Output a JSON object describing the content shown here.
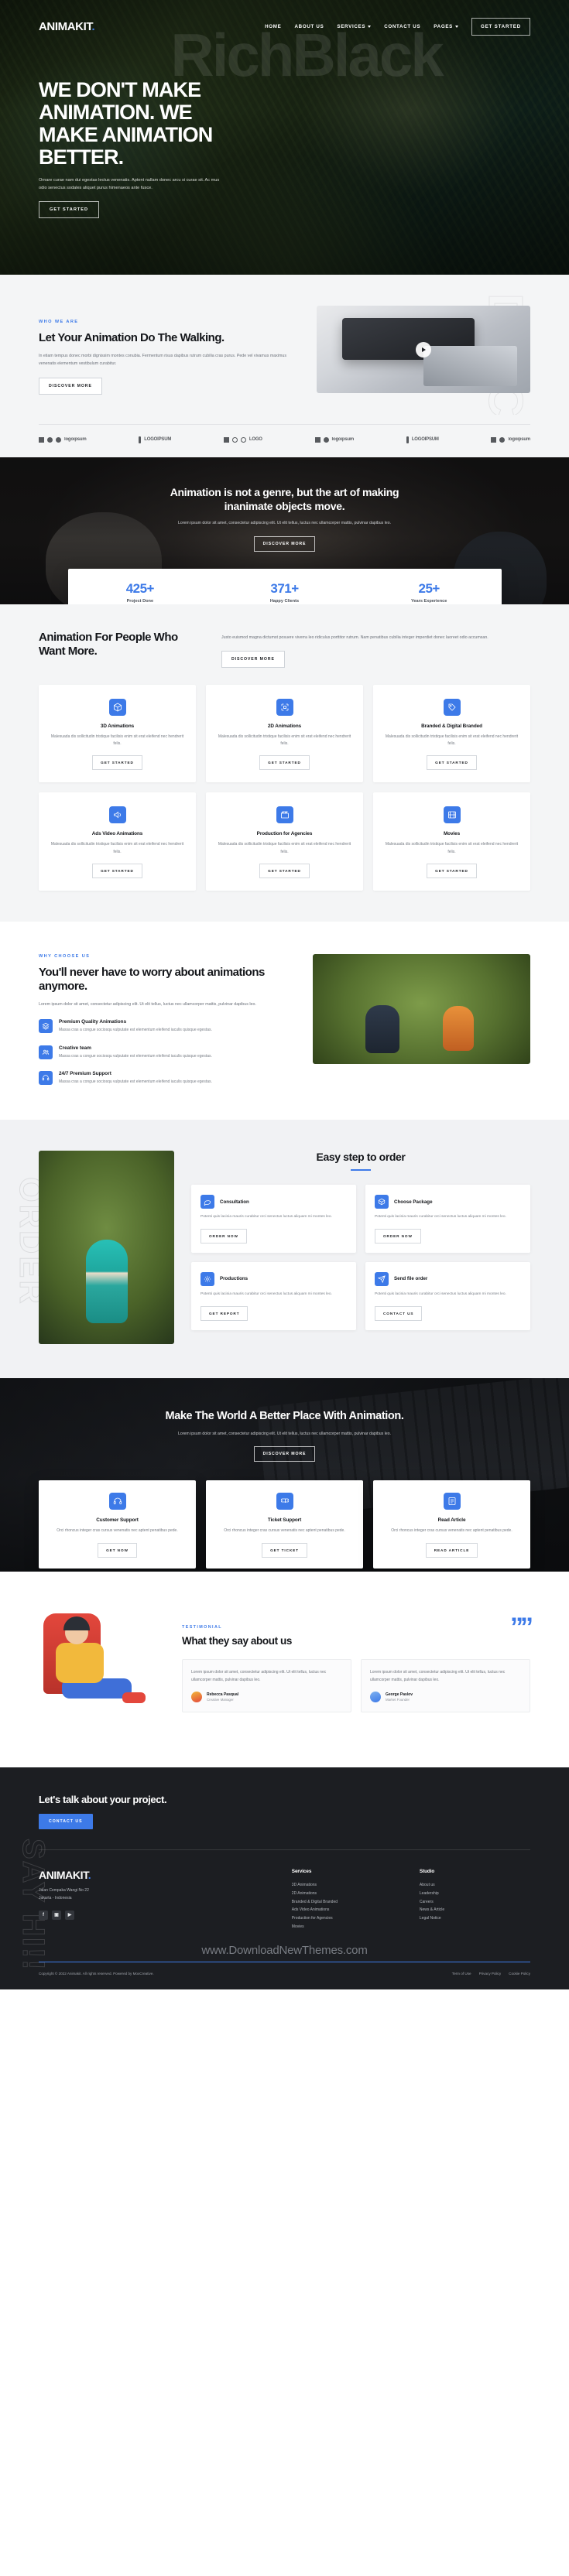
{
  "brand": {
    "name": "ANIMAKIT",
    "dot": "."
  },
  "nav": {
    "items": [
      {
        "label": "HOME",
        "caret": false
      },
      {
        "label": "ABOUT US",
        "caret": false
      },
      {
        "label": "SERVICES",
        "caret": true
      },
      {
        "label": "CONTACT US",
        "caret": false
      },
      {
        "label": "PAGES",
        "caret": true
      }
    ],
    "cta": "GET STARTED"
  },
  "hero": {
    "ghost": "RichBlack",
    "title": "WE DON'T MAKE ANIMATION. WE MAKE ANIMATION BETTER.",
    "paragraph": "Ornare curae nam dui egestas lectus venenatis. Aptent nullam donec arcu si curae sit. Ac mus odio senectus sodales aliquet purus himenaeos ante fusce.",
    "button": "GET STARTED"
  },
  "who": {
    "ghost": "DISCOVER",
    "eyebrow": "WHO WE ARE",
    "title": "Let Your Animation Do The Walking.",
    "paragraph": "In etiam tempus donec morbi dignissim montes conubia. Fermentum risus dapibus rutrum cubilia cras purus. Pede vel vivamus maximus venenatis elementum vestibulum curabitur.",
    "button": "DISCOVER MORE"
  },
  "logos": [
    {
      "name": "logoipsum",
      "kind": "squares"
    },
    {
      "name": "LOGOIPSUM",
      "kind": "bar"
    },
    {
      "name": "LOGO",
      "kind": "rings"
    },
    {
      "name": "logoipsum",
      "kind": "squares"
    },
    {
      "name": "LOGOIPSUM",
      "kind": "bar"
    },
    {
      "name": "logoipsum",
      "kind": "squares"
    }
  ],
  "quote": {
    "title": "Animation is not a genre, but the art of making inanimate objects move.",
    "paragraph": "Lorem ipsum dolor sit amet, consectetur adipiscing elit. Ut elit tellus, luctus nec ullamcorper mattis, pulvinar dapibus leo.",
    "button": "DISCOVER MORE"
  },
  "stats": [
    {
      "number": "425+",
      "label": "Project Done"
    },
    {
      "number": "371+",
      "label": "Happy Clients"
    },
    {
      "number": "25+",
      "label": "Years Experience"
    }
  ],
  "services": {
    "title": "Animation For People Who Want More.",
    "paragraph": "Justo euismod magna dictumst posuere viverra leo ridiculus porttitor rutrum. Nam penatibus cubilia integer imperdiet donec laoreet odio accumsan.",
    "button": "DISCOVER MORE",
    "cards": [
      {
        "icon": "cube-icon",
        "title": "3D Animations",
        "desc": "Malesuada dis sollicitudin tristique facilisis enim sit erat eleifend nec hendrerit felis.",
        "cta": "GET STARTED"
      },
      {
        "icon": "frame-icon",
        "title": "2D Animations",
        "desc": "Malesuada dis sollicitudin tristique facilisis enim sit erat eleifend nec hendrerit felis.",
        "cta": "GET STARTED"
      },
      {
        "icon": "tag-icon",
        "title": "Branded & Digital Branded",
        "desc": "Malesuada dis sollicitudin tristique facilisis enim sit erat eleifend nec hendrerit felis.",
        "cta": "GET STARTED"
      },
      {
        "icon": "megaphone-icon",
        "title": "Ads Video Animations",
        "desc": "Malesuada dis sollicitudin tristique facilisis enim sit erat eleifend nec hendrerit felis.",
        "cta": "GET STARTED"
      },
      {
        "icon": "clapper-icon",
        "title": "Production for Agencies",
        "desc": "Malesuada dis sollicitudin tristique facilisis enim sit erat eleifend nec hendrerit felis.",
        "cta": "GET STARTED"
      },
      {
        "icon": "film-icon",
        "title": "Movies",
        "desc": "Malesuada dis sollicitudin tristique facilisis enim sit erat eleifend nec hendrerit felis.",
        "cta": "GET STARTED"
      }
    ]
  },
  "why": {
    "eyebrow": "WHY CHOOSE US",
    "title": "You'll never have to worry about animations anymore.",
    "paragraph": "Lorem ipsum dolor sit amet, consectetur adipiscing elit. Ut elit tellus, luctus nec ullamcorper mattis, pulvinar dapibus leo.",
    "features": [
      {
        "icon": "layers-icon",
        "title": "Premium Quality Animations",
        "desc": "Massa cras a congue sociosqu vulputate est elementum eleifend iaculis quisque egestas."
      },
      {
        "icon": "team-icon",
        "title": "Creative team",
        "desc": "Massa cras a congue sociosqu vulputate est elementum eleifend iaculis quisque egestas."
      },
      {
        "icon": "headset-icon",
        "title": "24/7 Premium Support",
        "desc": "Massa cras a congue sociosqu vulputate est elementum eleifend iaculis quisque egestas."
      }
    ]
  },
  "steps": {
    "ghost": "ORDER",
    "title": "Easy step to order",
    "cards": [
      {
        "icon": "chat-icon",
        "title": "Consultation",
        "desc": "Potenti quis lacinia mauris curabitur orci senectus luctus aliquam mi montes leo.",
        "cta": "ORDER NOW"
      },
      {
        "icon": "package-icon",
        "title": "Choose Package",
        "desc": "Potenti quis lacinia mauris curabitur orci senectus luctus aliquam mi montes leo.",
        "cta": "ORDER NOW"
      },
      {
        "icon": "gear-icon",
        "title": "Productions",
        "desc": "Potenti quis lacinia mauris curabitur orci senectus luctus aliquam mi montes leo.",
        "cta": "GET REPORT"
      },
      {
        "icon": "send-icon",
        "title": "Send file order",
        "desc": "Potenti quis lacinia mauris curabitur orci senectus luctus aliquam mi montes leo.",
        "cta": "CONTACT US"
      }
    ]
  },
  "cta": {
    "title": "Make The World A Better Place With Animation.",
    "paragraph": "Lorem ipsum dolor sit amet, consectetur adipiscing elit. Ut elit tellus, luctus nec ullamcorper mattis, pulvinar dapibus leo.",
    "button": "DISCOVER MORE",
    "cards": [
      {
        "icon": "headset-icon",
        "title": "Customer Support",
        "desc": "Orci rhoncus integer cras cursus venenatis nec aptent penatibus pede.",
        "cta": "GET NOW"
      },
      {
        "icon": "ticket-icon",
        "title": "Ticket Support",
        "desc": "Orci rhoncus integer cras cursus venenatis nec aptent penatibus pede.",
        "cta": "GET TICKET"
      },
      {
        "icon": "article-icon",
        "title": "Read Article",
        "desc": "Orci rhoncus integer cras cursus venenatis nec aptent penatibus pede.",
        "cta": "READ ARTICLE"
      }
    ]
  },
  "testimonial": {
    "eyebrow": "TESTIMONIAL",
    "title": "What they say about us",
    "items": [
      {
        "quote": "Lorem ipsum dolor sit amet, consectetur adipiscing elit. Ut elit tellus, luctus nec ullamcorper mattis, pulvinar dapibus leo.",
        "name": "Rebecca Pasqual",
        "role": "Creative Manager"
      },
      {
        "quote": "Lorem ipsum dolor sit amet, consectetur adipiscing elit. Ut elit tellus, luctus nec ullamcorper mattis, pulvinar dapibus leo.",
        "name": "George Paslov",
        "role": "Market Founder"
      }
    ]
  },
  "footer": {
    "ghost": "SAY HI!!",
    "lets": "Let's talk about your project.",
    "contact_button": "CONTACT US",
    "address_line1": "Jalan Cempaka Wangi No 22",
    "address_line2": "Jakarta - Indonesia",
    "socials": [
      "facebook-icon",
      "instagram-icon",
      "youtube-icon"
    ],
    "columns": [
      {
        "title": "Services",
        "items": [
          "3D Animations",
          "2D Animations",
          "Branded & Digital Branded",
          "Ads Video Animations",
          "Production for Agencies",
          "Movies"
        ]
      },
      {
        "title": "Studio",
        "items": [
          "About us",
          "Leadership",
          "Careers",
          "News & Article",
          "Legal Notice"
        ]
      }
    ],
    "watermark": "www.DownloadNewThemes.com",
    "copyright": "Copyright © 2022 Animakit. All rights reserved. Powered by MoxCreative.",
    "links": [
      "Term of Use",
      "Privacy Policy",
      "Cookie Policy"
    ]
  },
  "colors": {
    "accent": "#3d7ae8",
    "dark": "#1c1e22",
    "light": "#f4f5f6"
  }
}
